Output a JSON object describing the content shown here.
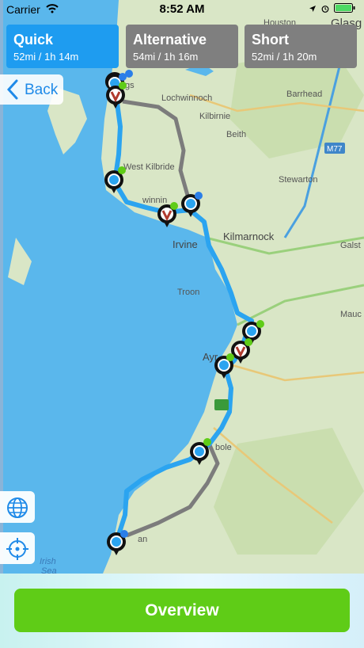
{
  "status": {
    "carrier": "Carrier",
    "time": "8:52 AM"
  },
  "routes": [
    {
      "name": "Quick",
      "info": "52mi / 1h 14m",
      "selected": true
    },
    {
      "name": "Alternative",
      "info": "54mi / 1h 16m",
      "selected": false
    },
    {
      "name": "Short",
      "info": "52mi / 1h 20m",
      "selected": false
    }
  ],
  "nav": {
    "back_label": "Back"
  },
  "map": {
    "labels": {
      "houston": "Houston",
      "glasgow": "Glasg",
      "largs": "gs",
      "lochwinnoch": "Lochwinnoch",
      "barrhead": "Barrhead",
      "kilbirnie": "Kilbirnie",
      "beith": "Beith",
      "west_kilbride": "West Kilbride",
      "stewarton": "Stewarton",
      "m77": "M77",
      "irvine": "Irvine",
      "kilmarnock": "Kilmarnock",
      "galston": "Galst",
      "troon": "Troon",
      "mauchline": "Mauc",
      "ayr": "Ayr",
      "maybole": "bole",
      "girvan": "an",
      "irish_sea_1": "Irish",
      "irish_sea_2": "Sea",
      "saltcoats": "winnin"
    },
    "colors": {
      "sea": "#5ab7ec",
      "land": "#d9e6c6",
      "route_main": "#2ba4f0",
      "route_alt": "#7c7c7c"
    }
  },
  "actions": {
    "overview_label": "Overview"
  }
}
